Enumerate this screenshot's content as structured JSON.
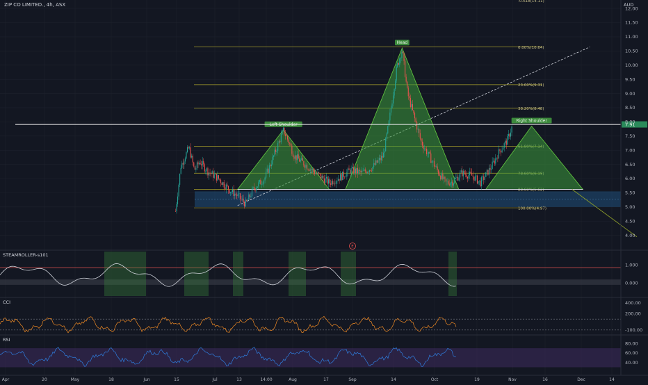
{
  "header": {
    "symbol": "ZIP CO LIMITED.",
    "interval": "4h",
    "exchange": "ASX"
  },
  "colors": {
    "bg": "#131722",
    "grid": "#1e222d",
    "up": "#26a69a",
    "down": "#ef5350",
    "fib": "#a8a02a",
    "pattern_fill": "#3c9b3c",
    "pattern_line": "#5fbf3f",
    "zone": "#1f4f7a",
    "cci": "#f08a24",
    "rsi": "#2f7fe0",
    "rsi_band": "#3a2a5a"
  },
  "chart_data": [
    {
      "type": "candlestick",
      "title": "ZIP CO LIMITED., 4h, ASX",
      "price_unit": "AUD",
      "y_ticks": [
        4.0,
        4.5,
        5.0,
        5.5,
        6.0,
        6.5,
        7.0,
        7.5,
        8.0,
        8.5,
        9.0,
        9.5,
        10.0,
        10.5,
        11.0,
        11.5,
        12.0
      ],
      "ylim": [
        3.6,
        12.1
      ],
      "x_labels": [
        "Apr",
        "20",
        "May",
        "18",
        "Jun",
        "15",
        "Jul",
        "13",
        "14:00",
        "Aug",
        "17",
        "Sep",
        "14",
        "Oct",
        "19",
        "Nov",
        "16",
        "Dec",
        "14"
      ],
      "price_path": [
        [
          "Jun 3",
          4.85
        ],
        [
          "Jun 5",
          6.45
        ],
        [
          "Jun 8",
          7.1
        ],
        [
          "Jun 10",
          6.3
        ],
        [
          "Jun 12",
          6.6
        ],
        [
          "Jun 15",
          6.25
        ],
        [
          "Jun 19",
          6.0
        ],
        [
          "Jun 23",
          5.6
        ],
        [
          "Jun 26",
          5.4
        ],
        [
          "Jun 29",
          5.1
        ],
        [
          "Jul 2",
          5.65
        ],
        [
          "Jul 6",
          6.0
        ],
        [
          "Jul 9",
          6.7
        ],
        [
          "Jul 13",
          7.7
        ],
        [
          "Jul 15",
          7.3
        ],
        [
          "Jul 17",
          6.8
        ],
        [
          "Jul 21",
          6.5
        ],
        [
          "Jul 25",
          6.2
        ],
        [
          "Jul 30",
          5.85
        ],
        [
          "Aug 3",
          6.05
        ],
        [
          "Aug 7",
          6.3
        ],
        [
          "Aug 11",
          6.2
        ],
        [
          "Aug 15",
          6.4
        ],
        [
          "Aug 19",
          6.8
        ],
        [
          "Aug 21",
          7.9
        ],
        [
          "Aug 24",
          9.9
        ],
        [
          "Aug 26",
          10.55
        ],
        [
          "Aug 28",
          9.0
        ],
        [
          "Aug 31",
          8.0
        ],
        [
          "Sep 2",
          7.3
        ],
        [
          "Sep 5",
          6.8
        ],
        [
          "Sep 8",
          6.3
        ],
        [
          "Sep 11",
          5.85
        ],
        [
          "Sep 14",
          5.9
        ],
        [
          "Sep 17",
          6.2
        ],
        [
          "Sep 21",
          6.1
        ],
        [
          "Sep 24",
          5.85
        ],
        [
          "Sep 28",
          6.4
        ],
        [
          "Oct 1",
          6.95
        ],
        [
          "Oct 4",
          7.35
        ],
        [
          "Oct 6",
          7.9
        ]
      ],
      "last_price": 7.91,
      "horizontal_line": 7.91,
      "fibonacci": {
        "levels": [
          {
            "label": "0.00%(10.64)",
            "value": 10.64
          },
          {
            "label": "23.60%(9.31)",
            "value": 9.31
          },
          {
            "label": "38.20%(8.48)",
            "value": 8.48
          },
          {
            "label": "61.80%(7.14)",
            "value": 7.14
          },
          {
            "label": "78.60%(6.19)",
            "value": 6.19
          },
          {
            "label": "88.60%(5.62)",
            "value": 5.62
          },
          {
            "label": "100.00%(4.97)",
            "value": 4.97
          }
        ],
        "top_label": "-0.618(14.11)",
        "diagonal": [
          [
            "Jun 26",
            5.05
          ],
          [
            "Nov 1",
            10.64
          ]
        ]
      },
      "pattern": {
        "neckline": [
          [
            "Jun 26",
            5.62
          ],
          [
            "Nov 1",
            5.62
          ]
        ],
        "left_shoulder": {
          "label": "Left Shoulder",
          "points": [
            [
              "Jun 26",
              5.62
            ],
            [
              "Jul 13",
              7.72
            ],
            [
              "Jul 30",
              5.62
            ]
          ]
        },
        "head": {
          "label": "Head",
          "points": [
            [
              "Aug 5",
              5.62
            ],
            [
              "Aug 26",
              10.6
            ],
            [
              "Sep 16",
              5.62
            ]
          ]
        },
        "right_shoulder": {
          "label": "Right Shoulder",
          "points": [
            [
              "Sep 26",
              5.62
            ],
            [
              "Oct 13",
              7.85
            ],
            [
              "Nov 1",
              5.62
            ]
          ]
        }
      },
      "support_zone": [
        5.0,
        5.55
      ],
      "projection": [
        [
          "Oct 28",
          5.62
        ],
        [
          "Nov 21",
          3.95
        ]
      ]
    },
    {
      "type": "line",
      "title": "STEAMROLLER-s101",
      "y_ticks": [
        "1.000",
        "0.000"
      ],
      "event_marker": "E"
    },
    {
      "type": "line",
      "title": "CCI",
      "y_ticks": [
        "400.00",
        "200.00",
        "-100.00"
      ],
      "threshold_lines": [
        100,
        -100
      ]
    },
    {
      "type": "line",
      "title": "RSI",
      "y_ticks": [
        "80.00",
        "60.00",
        "40.00"
      ],
      "band": [
        30,
        70
      ]
    }
  ]
}
